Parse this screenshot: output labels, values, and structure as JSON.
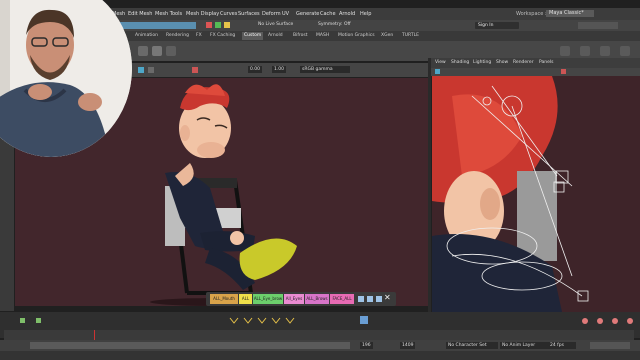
{
  "menubar": {
    "items": [
      "Mesh",
      "Edit Mesh",
      "Mesh Tools",
      "Mesh Display",
      "Curves",
      "Surfaces",
      "Deform",
      "UV",
      "Generate",
      "Cache",
      "Arnold",
      "Help"
    ],
    "workspace_label": "Workspace :",
    "workspace_value": "Maya Classic*"
  },
  "statusline": {
    "live_surface": "No Live Surface",
    "symmetry": "Symmetry: Off",
    "sign_in": "Sign In"
  },
  "shelf": {
    "tabs": [
      "Animation",
      "Rendering",
      "FX",
      "FX Caching",
      "Custom",
      "Arnold",
      "Bifrost",
      "MASH",
      "Motion Graphics",
      "XGen",
      "TURTLE"
    ],
    "active_tab": "Custom"
  },
  "viewport_left": {
    "exposure": "0.00",
    "gamma": "1.00",
    "color_space": "sRGB gamma"
  },
  "viewport_right": {
    "menu": [
      "View",
      "Shading",
      "Lighting",
      "Show",
      "Renderer",
      "Panels"
    ]
  },
  "selection_sets": {
    "buttons": [
      {
        "label": "ALL_Mouth",
        "color": "#d9a34a"
      },
      {
        "label": "ALL",
        "color": "#f0e04a"
      },
      {
        "label": "ALL_Eye_brow",
        "color": "#6ccf6c"
      },
      {
        "label": "All_Eyes",
        "color": "#e98bd1"
      },
      {
        "label": "ALL_Brows",
        "color": "#d774c8"
      },
      {
        "label": "FACE_ALL",
        "color": "#e86bb4"
      }
    ]
  },
  "timeline": {
    "start_field": "196",
    "end_field": "1409",
    "character_set": "No Character Set",
    "anim_layer": "No Anim Layer",
    "fps": "24 fps"
  },
  "colors": {
    "viewport_bg": "#42262c",
    "maya_blue": "#4ea7c9"
  }
}
